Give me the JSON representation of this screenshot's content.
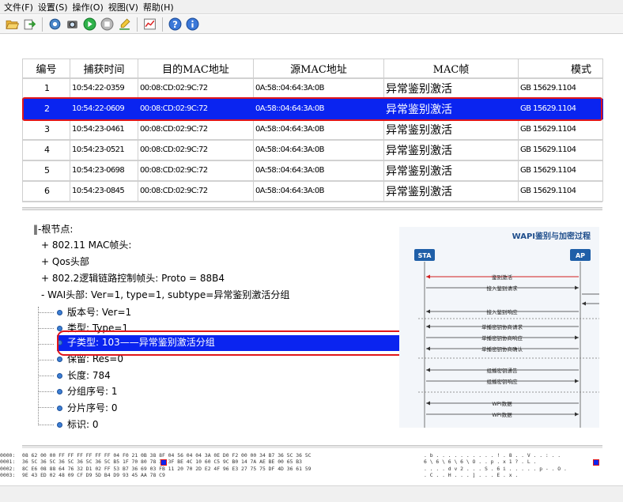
{
  "menu": [
    "文件(F)",
    "设置(S)",
    "操作(O)",
    "视图(V)",
    "帮助(H)"
  ],
  "toolbar_icons": [
    "folder-open-icon",
    "import-icon",
    "filter-icon",
    "capture-icon",
    "start-icon",
    "stop-icon",
    "clear-icon",
    "chart-icon",
    "help-icon",
    "info-icon"
  ],
  "columns": [
    "编号",
    "捕获时间",
    "目的MAC地址",
    "源MAC地址",
    "MAC帧",
    "模式"
  ],
  "rows": [
    {
      "no": "1",
      "time": "10:54:22-0359",
      "dst": "00:08:CD:02:9C:72",
      "src": "0A:58::04:64:3A:0B",
      "frame": "异常鉴别激活",
      "mode": "GB 15629.1104"
    },
    {
      "no": "2",
      "time": "10:54:22-0609",
      "dst": "00:08:CD:02:9C:72",
      "src": "0A:58::04:64:3A:0B",
      "frame": "异常鉴别激活",
      "mode": "GB 15629.1104"
    },
    {
      "no": "3",
      "time": "10:54:23-0461",
      "dst": "00:08:CD:02:9C:72",
      "src": "0A:58::04:64:3A:0B",
      "frame": "异常鉴别激活",
      "mode": "GB 15629.1104"
    },
    {
      "no": "4",
      "time": "10:54:23-0521",
      "dst": "00:08:CD:02:9C:72",
      "src": "0A:58::04:64:3A:0B",
      "frame": "异常鉴别激活",
      "mode": "GB 15629.1104"
    },
    {
      "no": "5",
      "time": "10:54:23-0698",
      "dst": "00:08:CD:02:9C:72",
      "src": "0A:58::04:64:3A:0B",
      "frame": "异常鉴别激活",
      "mode": "GB 15629.1104"
    },
    {
      "no": "6",
      "time": "10:54:23-0845",
      "dst": "00:08:CD:02:9C:72",
      "src": "0A:58::04:64:3A:0B",
      "frame": "异常鉴别激活",
      "mode": "GB 15629.1104"
    }
  ],
  "selected_row": "2",
  "tree": {
    "root": "‖-根节点:",
    "n1": "+ 802.11 MAC帧头:",
    "n2": "+ Qos头部",
    "n3": "+ 802.2逻辑链路控制帧头: Proto = 88B4",
    "n4": "- WAI头部: Ver=1, type=1, subtype=异常鉴别激活分组",
    "version": "版本号:  Ver=1",
    "type": "类型:   Type=1",
    "subtype": "子类型:  103——异常鉴别激活分组",
    "reserved": "保留:  Res=0",
    "length": "长度:  784",
    "seq": "分组序号: 1",
    "frag": "分片序号:  0",
    "flag": "标识:  0"
  },
  "figure": {
    "title": "WAPI鉴别与加密过程",
    "sta": "STA",
    "ap": "AP",
    "msgs": [
      "鉴别激活",
      "接入鉴别请求",
      "接入鉴别响应",
      "单播密钥协商请求",
      "单播密钥协商响应",
      "单播密钥协商确认",
      "组播密钥通告",
      "组播密钥响应",
      "WPI数据",
      "WPI数据"
    ]
  },
  "hex": {
    "offsets": [
      "0000:",
      "0001:",
      "0002:",
      "0003:"
    ],
    "bytes": [
      "08 62 00 00 FF FF FF FF FF FF 04 F0 21 0B 38 8F 04 56 04 04 3A 0E D0 F2 00 00 34 B7 36 5C 36 5C",
      "36 5C 36 5C 36 5C 36 5C 36 5C    B5 1F 70 80 78 31 3F BE 4C 10 60 C5 9C B0 14 7A AE BE 00 65 B3",
      "8C E6 08 88 64 76 32 D1 02 FF 53 B7 36 69 03 FB 11 20 70 2D E2 4F 96 E3 27 75 75 DF 4D 36 61 59",
      "9E 43 ED 02 48 09 CF D9 5D B4 D9 93 45 AA 78 C9"
    ],
    "ascii": [
      ". b . . . . . . . . . . ! . 8 . . V . . : . .",
      "6 \\ 6 \\ 6 \\ 6 \\ O . . p . x 1 ? . L .",
      ". . . . d v 2 . . . S . 6 i . . . . . p - . O .",
      ". C . . H . . . ] . . . E . x ."
    ]
  }
}
